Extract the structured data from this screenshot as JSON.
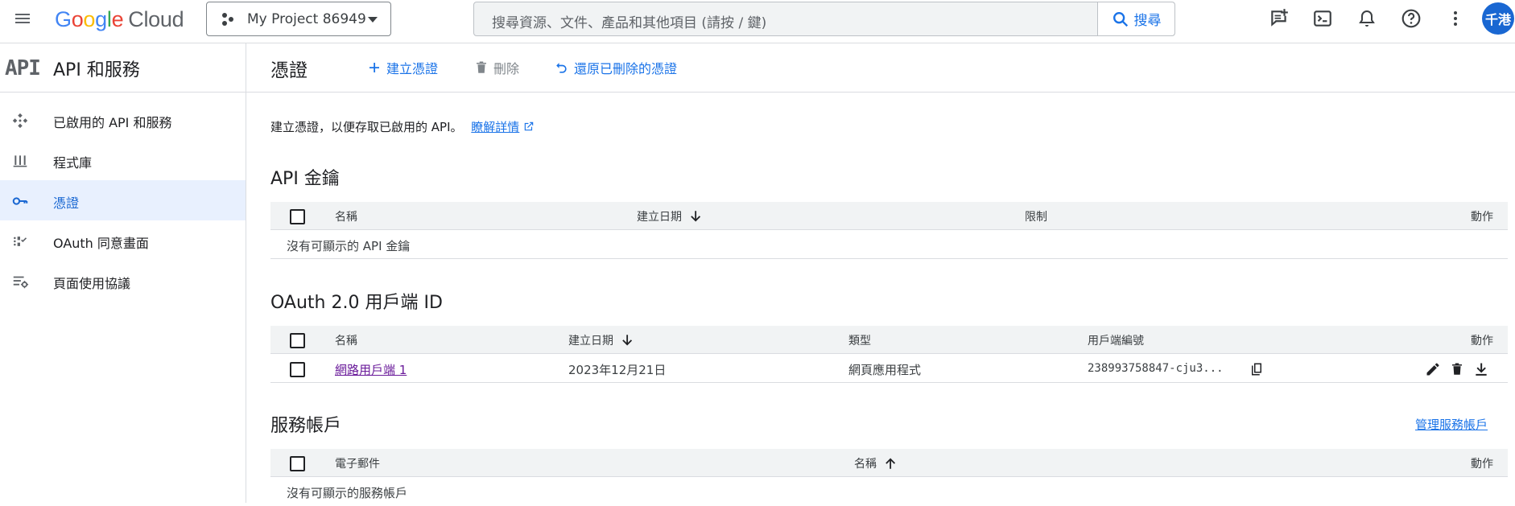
{
  "topbar": {
    "logo_google": "Google",
    "logo_cloud": "Cloud",
    "project_name": "My Project 86949",
    "search_placeholder": "搜尋資源、文件、產品和其他項目 (請按 / 鍵)",
    "search_button": "搜尋",
    "avatar_text": "千港",
    "icons": [
      "menu-icon",
      "project-dots-icon",
      "search-icon",
      "feedback-icon",
      "cloud-shell-icon",
      "notifications-icon",
      "help-icon",
      "more-vert-icon"
    ]
  },
  "sidenav": {
    "logo": "API",
    "title": "API 和服務",
    "items": [
      {
        "label": "已啟用的 API 和服務",
        "icon": "api-hub-icon",
        "active": false
      },
      {
        "label": "程式庫",
        "icon": "library-icon",
        "active": false
      },
      {
        "label": "憑證",
        "icon": "key-icon",
        "active": true
      },
      {
        "label": "OAuth 同意畫面",
        "icon": "consent-dots-icon",
        "active": false
      },
      {
        "label": "頁面使用協議",
        "icon": "settings-list-icon",
        "active": false
      }
    ]
  },
  "page": {
    "title": "憑證",
    "actions": {
      "create": "建立憑證",
      "delete": "刪除",
      "restore": "還原已刪除的憑證"
    },
    "intro_text": "建立憑證，以便存取已啟用的 API。",
    "learn_more": "瞭解詳情"
  },
  "api_keys": {
    "heading": "API 金鑰",
    "columns": [
      "名稱",
      "建立日期",
      "限制",
      "動作"
    ],
    "empty_text": "沒有可顯示的 API 金鑰"
  },
  "oauth": {
    "heading": "OAuth 2.0 用戶端 ID",
    "columns": [
      "名稱",
      "建立日期",
      "類型",
      "用戶端編號",
      "動作"
    ],
    "rows": [
      {
        "name": "網路用戶端 1",
        "date": "2023年12月21日",
        "type": "網頁應用程式",
        "client_id": "238993758847-cju3..."
      }
    ]
  },
  "service_accounts": {
    "heading": "服務帳戶",
    "manage_link": "管理服務帳戶",
    "columns": [
      "電子郵件",
      "名稱",
      "動作"
    ],
    "empty_text": "沒有可顯示的服務帳戶"
  },
  "colors": {
    "accent": "#1a73e8",
    "active_bg": "#e8f0fe",
    "header_bg": "#f1f3f4",
    "visited_link": "#6a1b9a"
  }
}
